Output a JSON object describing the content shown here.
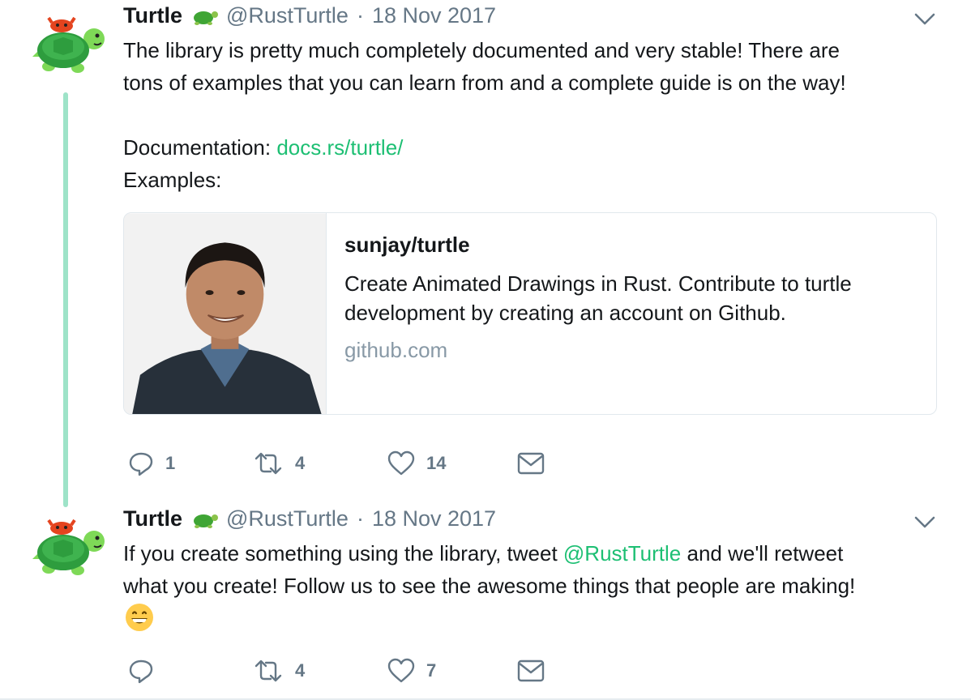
{
  "colors": {
    "link": "#1dbf73",
    "muted": "#657786",
    "thread": "#9ee3c8"
  },
  "tweets": [
    {
      "name": "Turtle",
      "handle": "@RustTurtle",
      "separator": "·",
      "date": "18 Nov 2017",
      "line1": "The library is pretty much completely documented and very stable! There are",
      "line2": "tons of examples that you can learn from and a complete guide is on the way!",
      "doc_label": "Documentation: ",
      "doc_link": "docs.rs/turtle/",
      "examples_label": "Examples:",
      "card": {
        "title": "sunjay/turtle",
        "desc_line1": "Create Animated Drawings in Rust. Contribute to turtle",
        "desc_line2": "development by creating an account on Github.",
        "domain": "github.com"
      },
      "replies": "1",
      "retweets": "4",
      "likes": "14"
    },
    {
      "name": "Turtle",
      "handle": "@RustTurtle",
      "separator": "·",
      "date": "18 Nov 2017",
      "line1_pre": "If you create something using the library, tweet ",
      "line1_mention": "@RustTurtle",
      "line1_post": " and we'll retweet",
      "line2": "what you create! Follow us to see the awesome things that people are making!",
      "retweets": "4",
      "likes": "7"
    }
  ]
}
